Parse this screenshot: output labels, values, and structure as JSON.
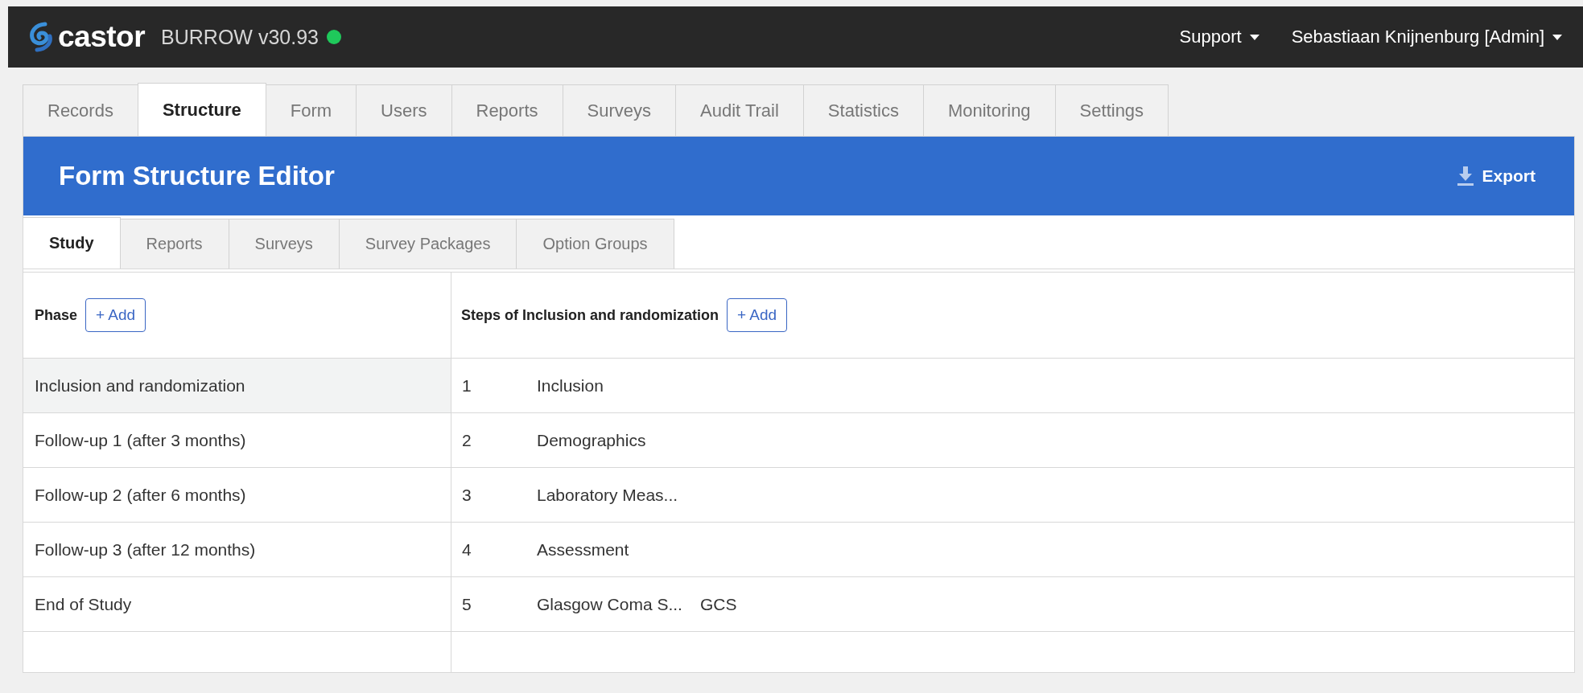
{
  "header": {
    "logo": "castor",
    "study": "BURROW v30.93",
    "online": true,
    "menus": [
      "Support",
      "Sebastiaan Knijnenburg [Admin]"
    ]
  },
  "tabs": [
    {
      "label": "Records",
      "selected": false
    },
    {
      "label": "Structure",
      "selected": true
    },
    {
      "label": "Form",
      "selected": false
    },
    {
      "label": "Users",
      "selected": false
    },
    {
      "label": "Reports",
      "selected": false
    },
    {
      "label": "Surveys",
      "selected": false
    },
    {
      "label": "Audit Trail",
      "selected": false
    },
    {
      "label": "Statistics",
      "selected": false
    },
    {
      "label": "Monitoring",
      "selected": false
    },
    {
      "label": "Settings",
      "selected": false
    }
  ],
  "editor": {
    "title": "Form Structure Editor",
    "export": "Export",
    "tabs": [
      {
        "label": "Study",
        "selected": true
      },
      {
        "label": "Reports",
        "selected": false
      },
      {
        "label": "Surveys",
        "selected": false
      },
      {
        "label": "Survey Packages",
        "selected": false
      },
      {
        "label": "Option Groups",
        "selected": false
      }
    ],
    "phase_label": "Phase",
    "phase_add": "+ Add",
    "steps_label": "Steps of Inclusion and randomization",
    "steps_add": "+ Add",
    "phases": [
      {
        "name": "Inclusion and randomization",
        "selected": true
      },
      {
        "name": "Follow-up 1 (after 3 months)",
        "selected": false
      },
      {
        "name": "Follow-up 2 (after 6 months)",
        "selected": false
      },
      {
        "name": "Follow-up 3 (after 12 months)",
        "selected": false
      },
      {
        "name": "End of Study",
        "selected": false
      }
    ],
    "steps": [
      {
        "number": "1",
        "name": "Inclusion"
      },
      {
        "number": "2",
        "name": "Demographics"
      },
      {
        "number": "3",
        "name": "Laboratory Meas..."
      },
      {
        "number": "4",
        "name": "Assessment"
      },
      {
        "number": "5",
        "name": "Glasgow Coma S...",
        "abbreviation": "GCS"
      }
    ]
  }
}
